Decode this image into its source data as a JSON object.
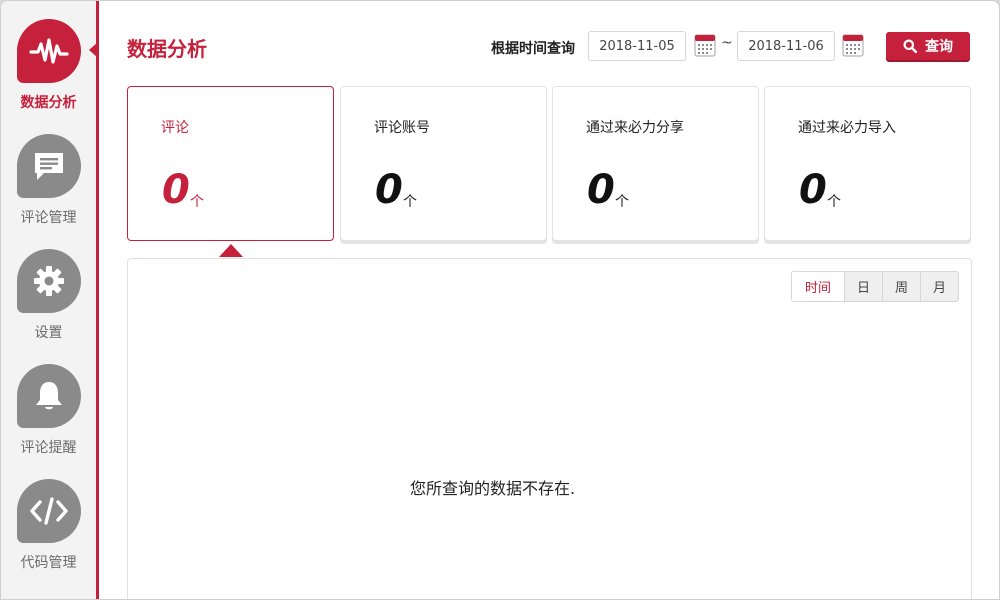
{
  "sidebar": {
    "items": [
      {
        "label": "数据分析",
        "icon": "pulse-icon",
        "active": true
      },
      {
        "label": "评论管理",
        "icon": "comment-icon",
        "active": false
      },
      {
        "label": "设置",
        "icon": "gear-icon",
        "active": false
      },
      {
        "label": "评论提醒",
        "icon": "bell-icon",
        "active": false
      },
      {
        "label": "代码管理",
        "icon": "code-icon",
        "active": false
      }
    ]
  },
  "header": {
    "title": "数据分析",
    "query_label": "根据时间查询",
    "start_date": "2018-11-05",
    "separator": "~",
    "end_date": "2018-11-06",
    "search_label": "查询"
  },
  "stats": [
    {
      "label": "评论",
      "value": "0",
      "unit": "个",
      "active": true
    },
    {
      "label": "评论账号",
      "value": "0",
      "unit": "个",
      "active": false
    },
    {
      "label": "通过来必力分享",
      "value": "0",
      "unit": "个",
      "active": false
    },
    {
      "label": "通过来必力导入",
      "value": "0",
      "unit": "个",
      "active": false
    }
  ],
  "panel": {
    "ranges": [
      "时间",
      "日",
      "周",
      "月"
    ],
    "active_range": "时间",
    "empty_message": "您所查询的数据不存在."
  },
  "colors": {
    "accent": "#c6213c",
    "icon_gray": "#8a8a8a",
    "sidebar_bg": "#f3f3f3"
  }
}
